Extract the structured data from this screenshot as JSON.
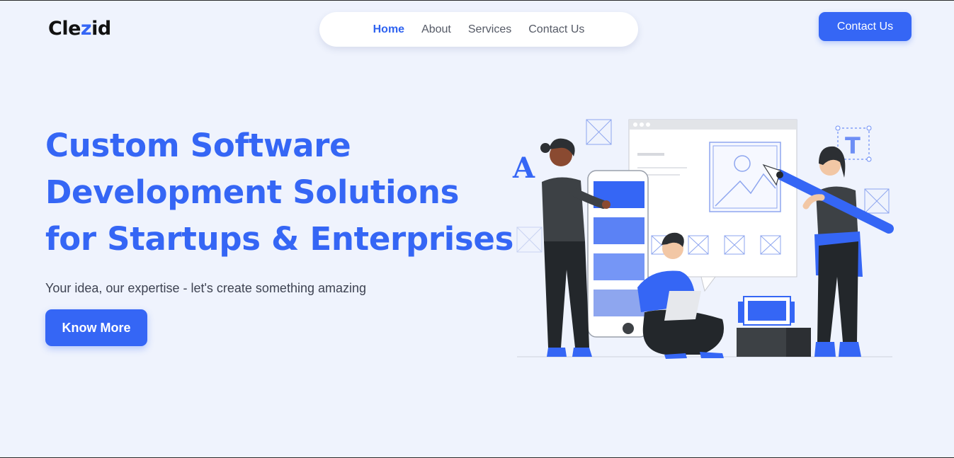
{
  "brand": {
    "name_start": "Cle",
    "name_accent": "z",
    "name_end": "id"
  },
  "nav": {
    "items": [
      {
        "label": "Home",
        "active": true
      },
      {
        "label": "About",
        "active": false
      },
      {
        "label": "Services",
        "active": false
      },
      {
        "label": "Contact Us",
        "active": false
      }
    ]
  },
  "header": {
    "cta_label": "Contact Us"
  },
  "hero": {
    "title_lines": [
      "Custom Software",
      "Development Solutions",
      "for Startups & Enterprises"
    ],
    "tagline": "Your idea, our expertise - let's create something amazing",
    "button_label": "Know More"
  },
  "illustration": {
    "letter_a": "A",
    "letter_t": "T",
    "icon": "team-working-illustration"
  },
  "colors": {
    "accent": "#3566f5",
    "background": "#eff3fd",
    "text_dark": "#3e4352"
  }
}
